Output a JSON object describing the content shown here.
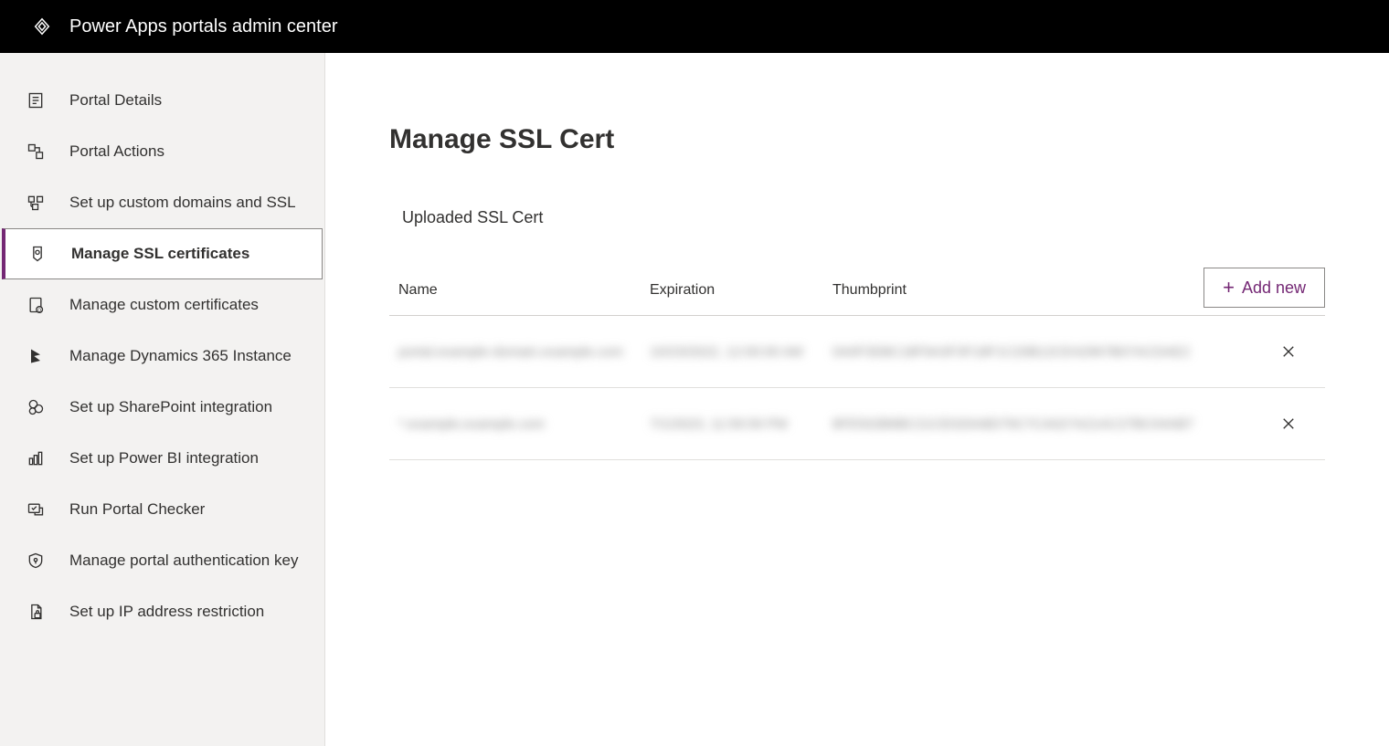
{
  "header": {
    "title": "Power Apps portals admin center",
    "icon": "power-apps-icon"
  },
  "sidebar": {
    "items": [
      {
        "label": "Portal Details",
        "icon": "details-icon",
        "active": false
      },
      {
        "label": "Portal Actions",
        "icon": "actions-icon",
        "active": false
      },
      {
        "label": "Set up custom domains and SSL",
        "icon": "domains-icon",
        "active": false
      },
      {
        "label": "Manage SSL certificates",
        "icon": "ssl-cert-icon",
        "active": true
      },
      {
        "label": "Manage custom certificates",
        "icon": "custom-cert-icon",
        "active": false
      },
      {
        "label": "Manage Dynamics 365 Instance",
        "icon": "dynamics-icon",
        "active": false
      },
      {
        "label": "Set up SharePoint integration",
        "icon": "sharepoint-icon",
        "active": false
      },
      {
        "label": "Set up Power BI integration",
        "icon": "powerbi-icon",
        "active": false
      },
      {
        "label": "Run Portal Checker",
        "icon": "checker-icon",
        "active": false
      },
      {
        "label": "Manage portal authentication key",
        "icon": "auth-key-icon",
        "active": false
      },
      {
        "label": "Set up IP address restriction",
        "icon": "ip-restrict-icon",
        "active": false
      }
    ]
  },
  "main": {
    "page_title": "Manage SSL Cert",
    "section_title": "Uploaded SSL Cert",
    "add_new_label": "Add new",
    "columns": {
      "name": "Name",
      "expiration": "Expiration",
      "thumbprint": "Thumbprint"
    },
    "rows": [
      {
        "name": "portal.example-domain.example.com",
        "expiration": "10/23/2022, 12:00:00 AM",
        "thumbprint": "0A0F3D8C18F9A3F3F18F1C20B12CE42967B07ACDAE2"
      },
      {
        "name": "*.example.example.com",
        "expiration": "7/1/2023, 11:59:59 PM",
        "thumbprint": "8FE502B6BC21CE020A8D79C7CA027A21AC27BC04AB7"
      }
    ]
  }
}
